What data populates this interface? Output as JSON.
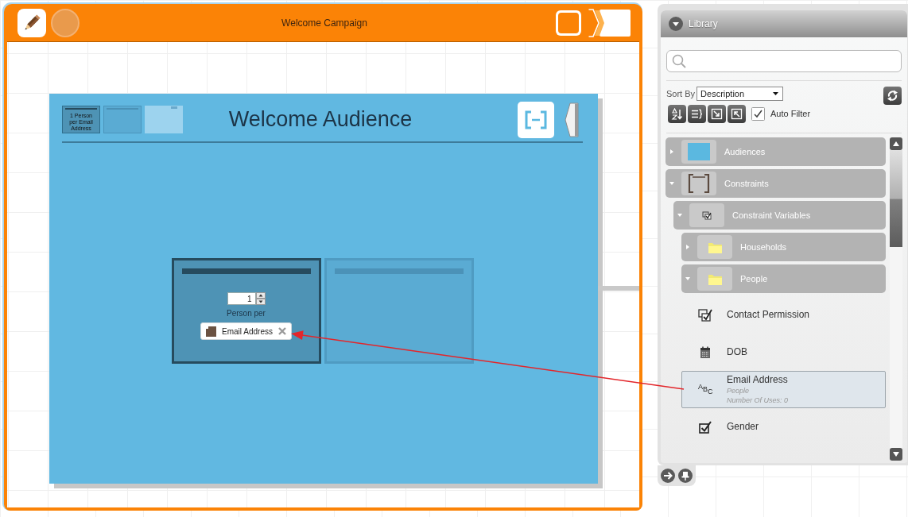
{
  "campaign": {
    "title": "Welcome Campaign"
  },
  "audience": {
    "title": "Welcome Audience",
    "thumbnails": [
      {
        "kind": "constraint",
        "label": "1 Person per Email Address",
        "selected": true
      },
      {
        "kind": "constraint",
        "selected": false
      },
      {
        "kind": "blank",
        "selected": false
      }
    ],
    "constraints": [
      {
        "selected": true,
        "count": "1",
        "caption": "Person per",
        "variable": "Email Address"
      },
      {
        "selected": false
      }
    ]
  },
  "library": {
    "title": "Library",
    "sort": {
      "label": "Sort By",
      "value": "Description"
    },
    "auto_filter": {
      "label": "Auto Filter",
      "checked": true
    },
    "tree": [
      {
        "kind": "audiences",
        "label": "Audiences",
        "expanded": false,
        "selected": false
      },
      {
        "kind": "constraints",
        "label": "Constraints",
        "expanded": true,
        "selected": false,
        "children": [
          {
            "kind": "variables",
            "label": "Constraint Variables",
            "expanded": true,
            "selected": false,
            "children": [
              {
                "kind": "folder",
                "label": "Households",
                "expanded": false,
                "selected": false
              },
              {
                "kind": "folder",
                "label": "People",
                "expanded": true,
                "selected": false,
                "children": [
                  {
                    "kind": "multi-choice",
                    "label": "Contact Permission",
                    "selected": false
                  },
                  {
                    "kind": "date",
                    "label": "DOB",
                    "selected": false
                  },
                  {
                    "kind": "text",
                    "label": "Email Address",
                    "icon_text": "ABC",
                    "selected": true,
                    "details": [
                      "People",
                      "Number Of Uses: 0"
                    ]
                  },
                  {
                    "kind": "choice",
                    "label": "Gender",
                    "selected": false
                  }
                ]
              }
            ]
          }
        ]
      }
    ]
  }
}
